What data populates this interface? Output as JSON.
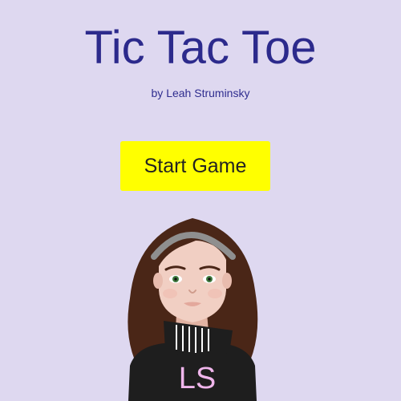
{
  "title": "Tic Tac Toe",
  "byline": "by Leah Struminsky",
  "start_button": {
    "label": "Start Game"
  },
  "avatar": {
    "initials": "LS"
  },
  "colors": {
    "background": "#ded8f0",
    "title": "#2c2a8c",
    "button": "#ffff00",
    "hair": "#4a2617",
    "shirt": "#1e1e1e",
    "initials": "#f0b6ec"
  }
}
